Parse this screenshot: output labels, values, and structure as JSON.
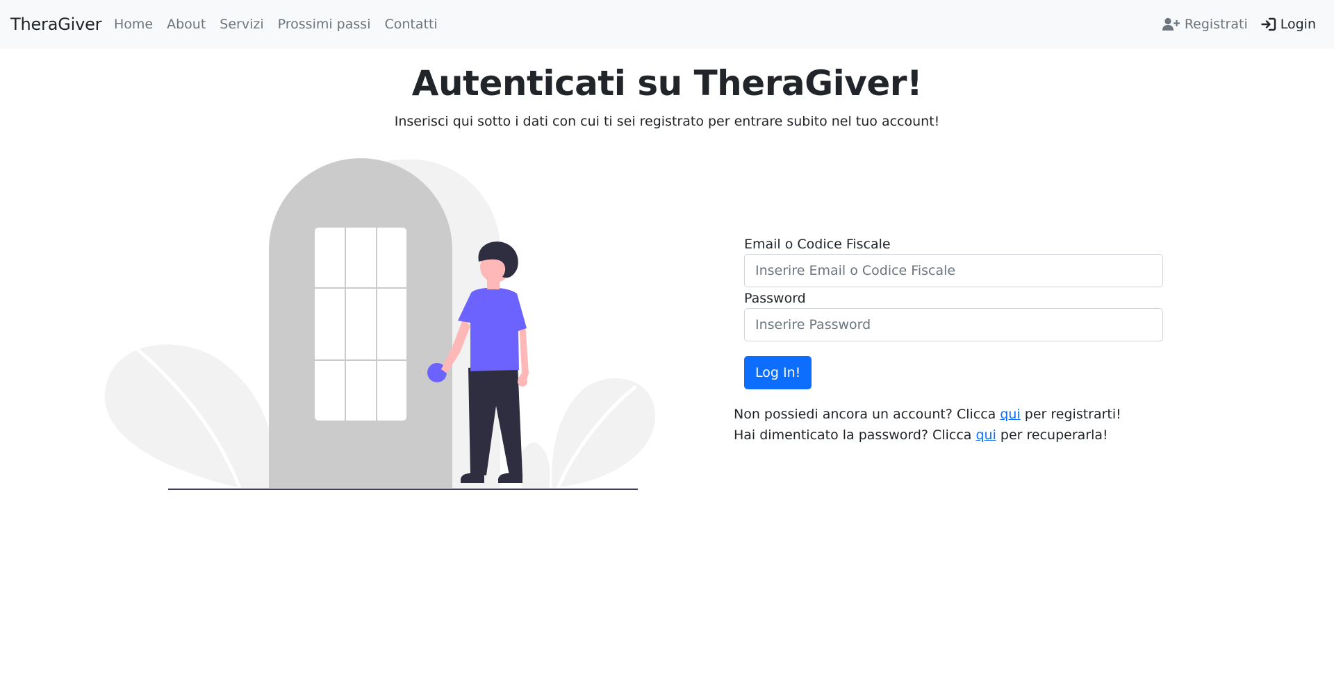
{
  "navbar": {
    "brand": "TheraGiver",
    "links": [
      "Home",
      "About",
      "Servizi",
      "Prossimi passi",
      "Contatti"
    ],
    "register_label": "Registrati",
    "register_icon": "user-plus-icon",
    "login_label": "Login",
    "login_icon": "sign-in-icon"
  },
  "header": {
    "title": "Autenticati su TheraGiver!",
    "subtitle": "Inserisci qui sotto i dati con cui ti sei registrato per entrare subito nel tuo account!"
  },
  "form": {
    "email_label": "Email o Codice Fiscale",
    "email_placeholder": "Inserire Email o Codice Fiscale",
    "password_label": "Password",
    "password_placeholder": "Inserire Password",
    "submit_label": "Log In!"
  },
  "help": {
    "register_prefix": "Non possiedi ancora un account? Clicca",
    "register_link": "qui",
    "register_suffix": "per registrarti!",
    "recover_prefix": "Hai dimenticato la password? Clicca",
    "recover_link": "qui",
    "recover_suffix": "per recuperarla!"
  },
  "colors": {
    "primary": "#0d6efd",
    "navbar_bg": "#f8f9fa",
    "illustration_accent": "#6c63ff",
    "illustration_dark": "#2f2e41"
  }
}
